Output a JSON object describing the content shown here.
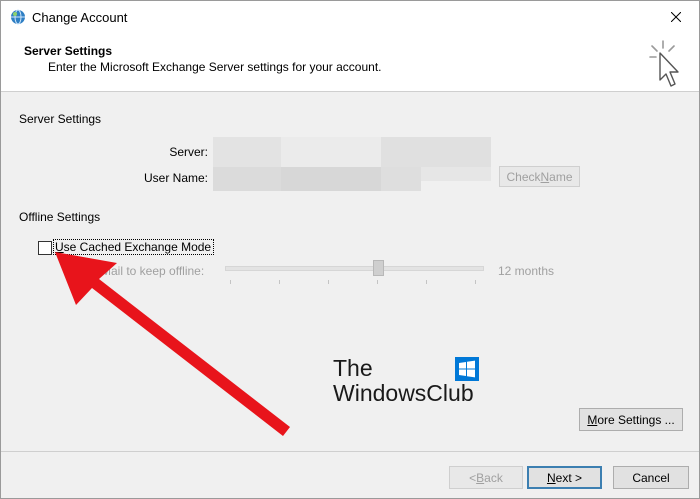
{
  "window": {
    "title": "Change Account"
  },
  "header": {
    "title": "Server Settings",
    "subtitle": "Enter the Microsoft Exchange Server settings for your account."
  },
  "server_settings": {
    "section_label": "Server Settings",
    "server_label": "Server:",
    "username_label": "User Name:",
    "check_name_pre": "Check ",
    "check_name_key": "N",
    "check_name_post": "ame"
  },
  "offline_settings": {
    "section_label": "Offline Settings",
    "cached_mode_pre": "",
    "cached_mode_key": "U",
    "cached_mode_post": "se Cached Exchange Mode",
    "cached_mode_checked": false,
    "mail_keep_label": "Mail to keep offline:",
    "mail_keep_value": "12 months",
    "slider_position_fraction": 0.59
  },
  "buttons": {
    "more_settings_pre": "",
    "more_settings_key": "M",
    "more_settings_post": "ore Settings ...",
    "back_pre": "< ",
    "back_key": "B",
    "back_post": "ack",
    "next_pre": "",
    "next_key": "N",
    "next_post": "ext >",
    "cancel": "Cancel"
  },
  "watermark": {
    "line1": "The",
    "line2": "WindowsClub"
  },
  "icons": [
    "globe-icon",
    "close-icon",
    "wizard-cursor-icon",
    "red-arrow-annotation"
  ],
  "colors": {
    "arrow": "#e8141b",
    "primary_border": "#3c7fb1"
  }
}
